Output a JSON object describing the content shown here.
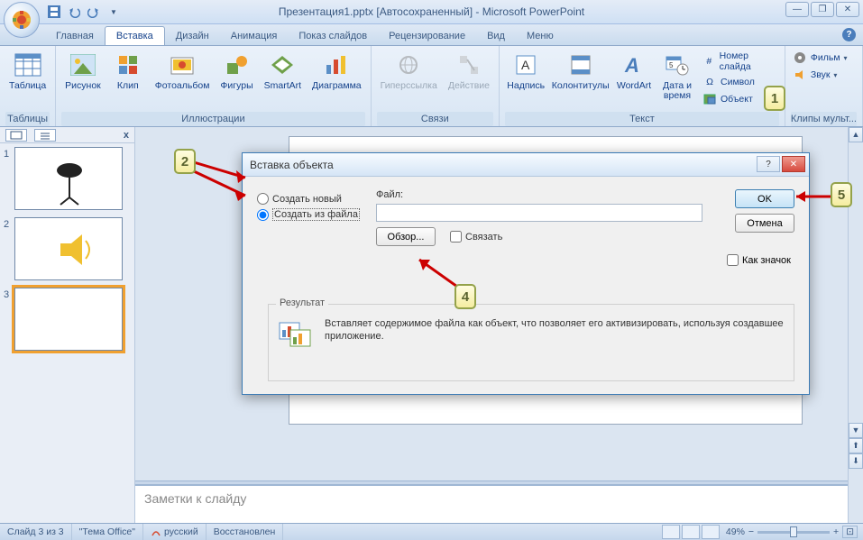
{
  "app": {
    "title": "Презентация1.pptx [Автосохраненный] - Microsoft PowerPoint"
  },
  "tabs": [
    "Главная",
    "Вставка",
    "Дизайн",
    "Анимация",
    "Показ слайдов",
    "Рецензирование",
    "Вид",
    "Меню"
  ],
  "active_tab": 1,
  "ribbon": {
    "tables": {
      "label": "Таблицы",
      "items": [
        {
          "label": "Таблица",
          "icon": "table"
        }
      ]
    },
    "illus": {
      "label": "Иллюстрации",
      "items": [
        {
          "label": "Рисунок",
          "icon": "picture"
        },
        {
          "label": "Клип",
          "icon": "clip"
        },
        {
          "label": "Фотоальбом",
          "icon": "album"
        },
        {
          "label": "Фигуры",
          "icon": "shapes"
        },
        {
          "label": "SmartArt",
          "icon": "smartart"
        },
        {
          "label": "Диаграмма",
          "icon": "chart"
        }
      ]
    },
    "links": {
      "label": "Связи",
      "items": [
        {
          "label": "Гиперссылка",
          "icon": "link",
          "disabled": true
        },
        {
          "label": "Действие",
          "icon": "action",
          "disabled": true
        }
      ]
    },
    "text": {
      "label": "Текст",
      "items": [
        {
          "label": "Надпись",
          "icon": "textbox"
        },
        {
          "label": "Колонтитулы",
          "icon": "headerfooter"
        },
        {
          "label": "WordArt",
          "icon": "wordart"
        },
        {
          "label": "Дата и\nвремя",
          "icon": "datetime"
        }
      ],
      "small": [
        {
          "label": "Номер слайда",
          "icon": "slidenum"
        },
        {
          "label": "Символ",
          "icon": "symbol"
        },
        {
          "label": "Объект",
          "icon": "object"
        }
      ]
    },
    "media": {
      "label": "Клипы мульт...",
      "small": [
        {
          "label": "Фильм",
          "icon": "movie"
        },
        {
          "label": "Звук",
          "icon": "sound"
        }
      ]
    }
  },
  "dialog": {
    "title": "Вставка объекта",
    "radio_new": "Создать новый",
    "radio_file": "Создать из файла",
    "file_label": "Файл:",
    "file_value": "",
    "browse": "Обзор...",
    "link": "Связать",
    "as_icon": "Как значок",
    "ok": "OK",
    "cancel": "Отмена",
    "result_label": "Результат",
    "result_text": "Вставляет содержимое файла как объект, что позволяет его активизировать, используя создавшее приложение."
  },
  "notes": {
    "placeholder": "Заметки к слайду"
  },
  "status": {
    "slide": "Слайд 3 из 3",
    "theme": "\"Тема Office\"",
    "lang": "русский",
    "recovered": "Восстановлен",
    "zoom": "49%"
  },
  "markers": {
    "m1": "1",
    "m2": "2",
    "m4": "4",
    "m5": "5"
  }
}
